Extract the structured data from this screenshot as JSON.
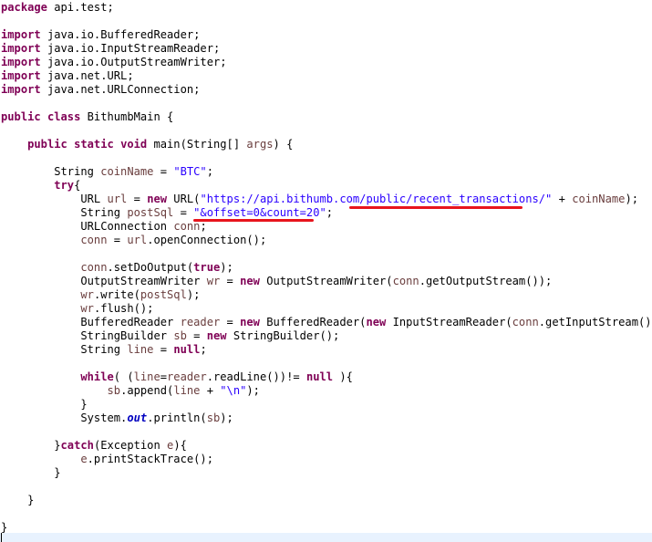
{
  "editor": {
    "language": "Java",
    "colors": {
      "keyword": "#7f0055",
      "string": "#2a00ff",
      "static_field": "#0000c0",
      "local_variable": "#6a3e3e",
      "annotation_underline": "#e8141c",
      "current_line_highlight": "#e8f2fe"
    },
    "lines": [
      [
        {
          "t": "keyword",
          "v": "package"
        },
        {
          "t": "plain",
          "v": " api.test;"
        }
      ],
      [],
      [
        {
          "t": "keyword",
          "v": "import"
        },
        {
          "t": "plain",
          "v": " java.io.BufferedReader;"
        }
      ],
      [
        {
          "t": "keyword",
          "v": "import"
        },
        {
          "t": "plain",
          "v": " java.io.InputStreamReader;"
        }
      ],
      [
        {
          "t": "keyword",
          "v": "import"
        },
        {
          "t": "plain",
          "v": " java.io.OutputStreamWriter;"
        }
      ],
      [
        {
          "t": "keyword",
          "v": "import"
        },
        {
          "t": "plain",
          "v": " java.net.URL;"
        }
      ],
      [
        {
          "t": "keyword",
          "v": "import"
        },
        {
          "t": "plain",
          "v": " java.net.URLConnection;"
        }
      ],
      [],
      [
        {
          "t": "keyword",
          "v": "public"
        },
        {
          "t": "plain",
          "v": " "
        },
        {
          "t": "keyword",
          "v": "class"
        },
        {
          "t": "plain",
          "v": " BithumbMain {"
        }
      ],
      [],
      [
        {
          "t": "plain",
          "v": "    "
        },
        {
          "t": "keyword",
          "v": "public"
        },
        {
          "t": "plain",
          "v": " "
        },
        {
          "t": "keyword",
          "v": "static"
        },
        {
          "t": "plain",
          "v": " "
        },
        {
          "t": "keyword",
          "v": "void"
        },
        {
          "t": "plain",
          "v": " main(String[] "
        },
        {
          "t": "local",
          "v": "args"
        },
        {
          "t": "plain",
          "v": ") {"
        }
      ],
      [],
      [
        {
          "t": "plain",
          "v": "        String "
        },
        {
          "t": "local",
          "v": "coinName"
        },
        {
          "t": "plain",
          "v": " = "
        },
        {
          "t": "string",
          "v": "\"BTC\""
        },
        {
          "t": "plain",
          "v": ";"
        }
      ],
      [
        {
          "t": "plain",
          "v": "        "
        },
        {
          "t": "keyword",
          "v": "try"
        },
        {
          "t": "plain",
          "v": "{"
        }
      ],
      [
        {
          "t": "plain",
          "v": "            URL "
        },
        {
          "t": "local",
          "v": "url"
        },
        {
          "t": "plain",
          "v": " = "
        },
        {
          "t": "keyword",
          "v": "new"
        },
        {
          "t": "plain",
          "v": " URL("
        },
        {
          "t": "string",
          "v": "\"https://api.bithumb.com/public/recent_transactions/\""
        },
        {
          "t": "plain",
          "v": " + "
        },
        {
          "t": "local",
          "v": "coinName"
        },
        {
          "t": "plain",
          "v": ");"
        }
      ],
      [
        {
          "t": "plain",
          "v": "            String "
        },
        {
          "t": "local",
          "v": "postSql"
        },
        {
          "t": "plain",
          "v": " = "
        },
        {
          "t": "string",
          "v": "\"&offset=0&count=20\""
        },
        {
          "t": "plain",
          "v": ";"
        }
      ],
      [
        {
          "t": "plain",
          "v": "            URLConnection "
        },
        {
          "t": "local",
          "v": "conn"
        },
        {
          "t": "plain",
          "v": ";"
        }
      ],
      [
        {
          "t": "plain",
          "v": "            "
        },
        {
          "t": "local",
          "v": "conn"
        },
        {
          "t": "plain",
          "v": " = "
        },
        {
          "t": "local",
          "v": "url"
        },
        {
          "t": "plain",
          "v": ".openConnection();"
        }
      ],
      [],
      [
        {
          "t": "plain",
          "v": "            "
        },
        {
          "t": "local",
          "v": "conn"
        },
        {
          "t": "plain",
          "v": ".setDoOutput("
        },
        {
          "t": "keyword",
          "v": "true"
        },
        {
          "t": "plain",
          "v": ");"
        }
      ],
      [
        {
          "t": "plain",
          "v": "            OutputStreamWriter "
        },
        {
          "t": "local",
          "v": "wr"
        },
        {
          "t": "plain",
          "v": " = "
        },
        {
          "t": "keyword",
          "v": "new"
        },
        {
          "t": "plain",
          "v": " OutputStreamWriter("
        },
        {
          "t": "local",
          "v": "conn"
        },
        {
          "t": "plain",
          "v": ".getOutputStream());"
        }
      ],
      [
        {
          "t": "plain",
          "v": "            "
        },
        {
          "t": "local",
          "v": "wr"
        },
        {
          "t": "plain",
          "v": ".write("
        },
        {
          "t": "local",
          "v": "postSql"
        },
        {
          "t": "plain",
          "v": ");"
        }
      ],
      [
        {
          "t": "plain",
          "v": "            "
        },
        {
          "t": "local",
          "v": "wr"
        },
        {
          "t": "plain",
          "v": ".flush();"
        }
      ],
      [
        {
          "t": "plain",
          "v": "            BufferedReader "
        },
        {
          "t": "local",
          "v": "reader"
        },
        {
          "t": "plain",
          "v": " = "
        },
        {
          "t": "keyword",
          "v": "new"
        },
        {
          "t": "plain",
          "v": " BufferedReader("
        },
        {
          "t": "keyword",
          "v": "new"
        },
        {
          "t": "plain",
          "v": " InputStreamReader("
        },
        {
          "t": "local",
          "v": "conn"
        },
        {
          "t": "plain",
          "v": ".getInputStream()));"
        }
      ],
      [
        {
          "t": "plain",
          "v": "            StringBuilder "
        },
        {
          "t": "local",
          "v": "sb"
        },
        {
          "t": "plain",
          "v": " = "
        },
        {
          "t": "keyword",
          "v": "new"
        },
        {
          "t": "plain",
          "v": " StringBuilder();"
        }
      ],
      [
        {
          "t": "plain",
          "v": "            String "
        },
        {
          "t": "local",
          "v": "line"
        },
        {
          "t": "plain",
          "v": " = "
        },
        {
          "t": "keyword",
          "v": "null"
        },
        {
          "t": "plain",
          "v": ";"
        }
      ],
      [],
      [
        {
          "t": "plain",
          "v": "            "
        },
        {
          "t": "keyword",
          "v": "while"
        },
        {
          "t": "plain",
          "v": "( ("
        },
        {
          "t": "local",
          "v": "line"
        },
        {
          "t": "plain",
          "v": "="
        },
        {
          "t": "local",
          "v": "reader"
        },
        {
          "t": "plain",
          "v": ".readLine())!= "
        },
        {
          "t": "keyword",
          "v": "null"
        },
        {
          "t": "plain",
          "v": " ){"
        }
      ],
      [
        {
          "t": "plain",
          "v": "                "
        },
        {
          "t": "local",
          "v": "sb"
        },
        {
          "t": "plain",
          "v": ".append("
        },
        {
          "t": "local",
          "v": "line"
        },
        {
          "t": "plain",
          "v": " + "
        },
        {
          "t": "string",
          "v": "\"\\n\""
        },
        {
          "t": "plain",
          "v": ");"
        }
      ],
      [
        {
          "t": "plain",
          "v": "            }"
        }
      ],
      [
        {
          "t": "plain",
          "v": "            System."
        },
        {
          "t": "static",
          "v": "out"
        },
        {
          "t": "plain",
          "v": ".println("
        },
        {
          "t": "local",
          "v": "sb"
        },
        {
          "t": "plain",
          "v": ");"
        }
      ],
      [],
      [
        {
          "t": "plain",
          "v": "        }"
        },
        {
          "t": "keyword",
          "v": "catch"
        },
        {
          "t": "plain",
          "v": "(Exception "
        },
        {
          "t": "local",
          "v": "e"
        },
        {
          "t": "plain",
          "v": "){"
        }
      ],
      [
        {
          "t": "plain",
          "v": "            "
        },
        {
          "t": "local",
          "v": "e"
        },
        {
          "t": "plain",
          "v": ".printStackTrace();"
        }
      ],
      [
        {
          "t": "plain",
          "v": "        }"
        }
      ],
      [],
      [
        {
          "t": "plain",
          "v": "    }"
        }
      ],
      [],
      [
        {
          "t": "plain",
          "v": "}"
        }
      ]
    ]
  }
}
